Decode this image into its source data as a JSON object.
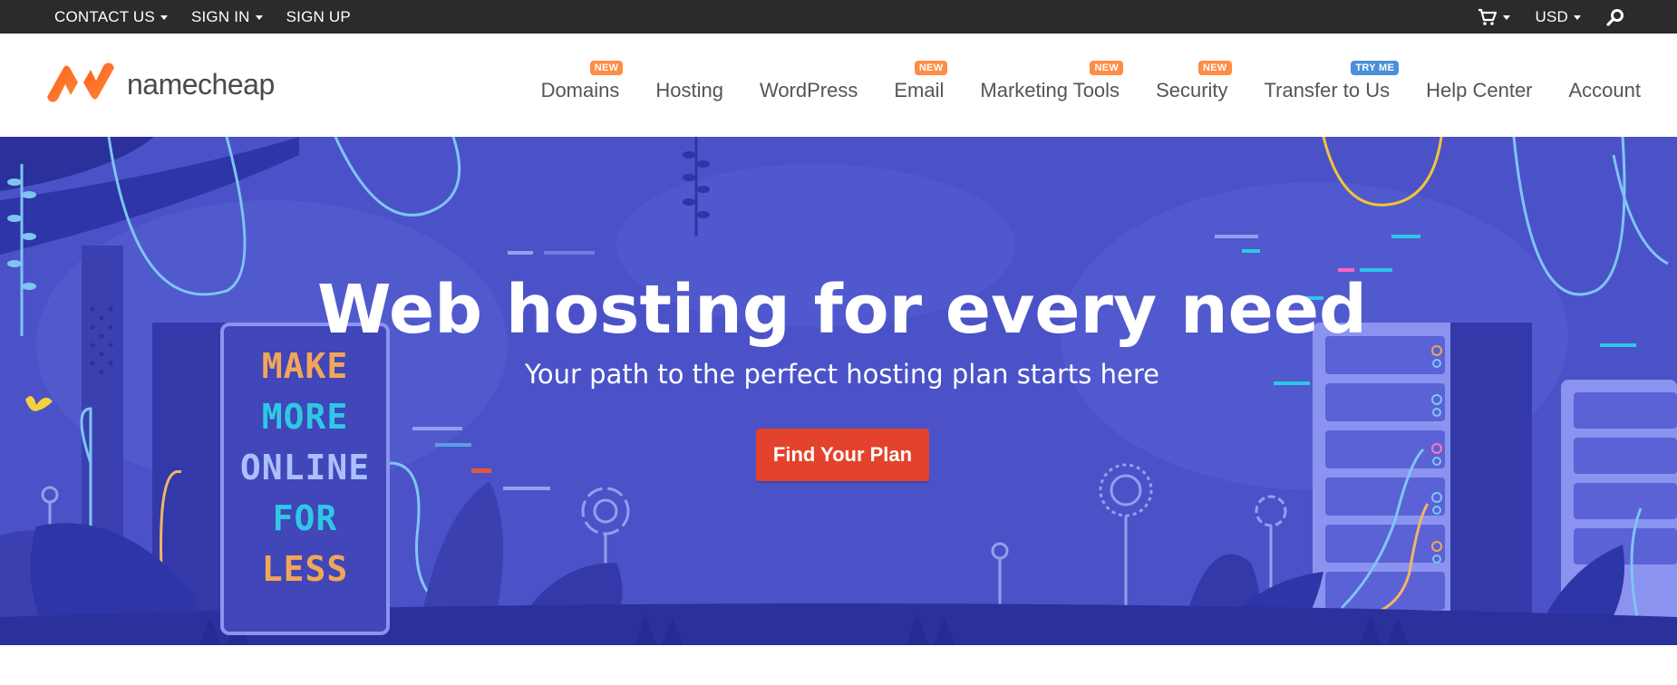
{
  "topbar": {
    "contact_label": "CONTACT US",
    "signin_label": "SIGN IN",
    "signup_label": "SIGN UP",
    "currency_label": "USD",
    "cart_icon": "cart-icon",
    "search_icon": "search-icon"
  },
  "brand": {
    "name": "namecheap",
    "accent": "#ff6c2c"
  },
  "nav": {
    "items": [
      {
        "label": "Domains",
        "badge": "NEW"
      },
      {
        "label": "Hosting",
        "badge": ""
      },
      {
        "label": "WordPress",
        "badge": ""
      },
      {
        "label": "Email",
        "badge": "NEW"
      },
      {
        "label": "Marketing Tools",
        "badge": "NEW"
      },
      {
        "label": "Security",
        "badge": "NEW"
      },
      {
        "label": "Transfer to Us",
        "badge": "TRY ME"
      },
      {
        "label": "Help Center",
        "badge": ""
      },
      {
        "label": "Account",
        "badge": ""
      }
    ]
  },
  "hero": {
    "title": "Web hosting for every need",
    "subtitle": "Your path to the perfect hosting plan starts here",
    "cta_label": "Find Your Plan",
    "sign_lines": [
      "MAKE",
      "MORE",
      "ONLINE",
      "FOR",
      "LESS"
    ],
    "background_color": "#4b52c8",
    "cta_color": "#e3432d"
  }
}
